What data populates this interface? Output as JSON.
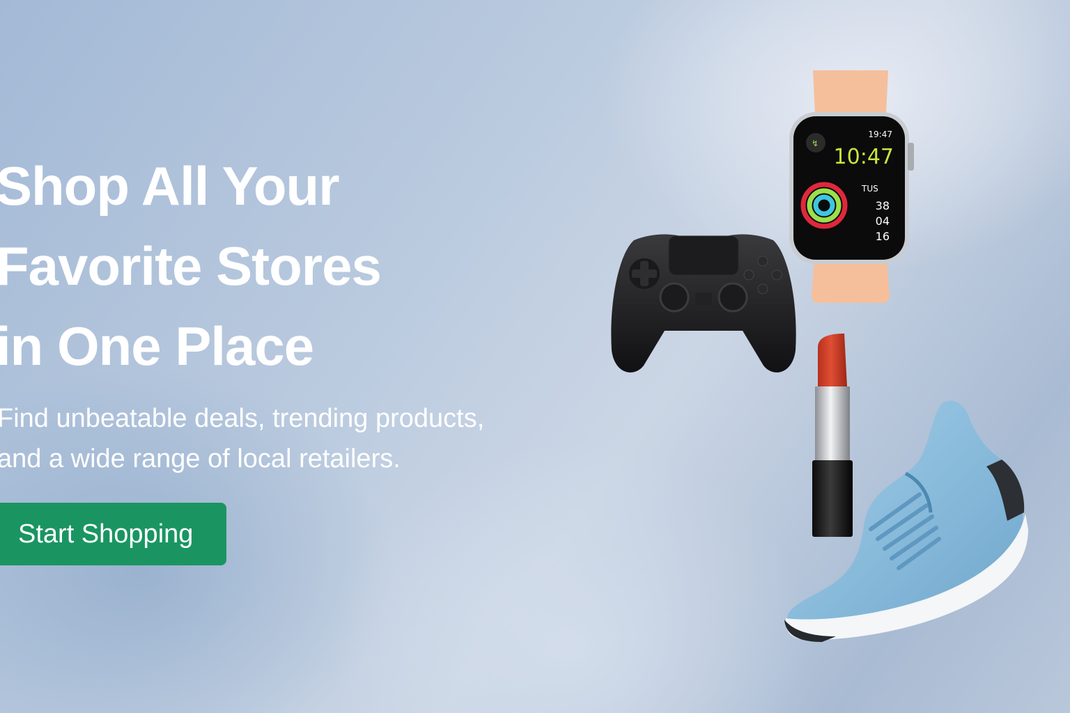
{
  "hero": {
    "headline_lines": [
      "Shop All Your",
      "Favorite Stores",
      "in One Place"
    ],
    "subtitle_lines": [
      "Find unbeatable deals, trending products,",
      "and a wide range of local retailers."
    ],
    "cta_label": "Start Shopping"
  },
  "watch_face": {
    "top_time": "19:47",
    "main_time": "10:47",
    "day": "TUS",
    "stats": [
      "38",
      "04",
      "16"
    ]
  },
  "colors": {
    "cta_background": "#1a9561",
    "headline_text": "#ffffff",
    "watch_band": "#f5bf9c",
    "watch_time_accent": "#c8e63c",
    "lipstick": "#d1412a",
    "sneaker": "#8fc0e0"
  },
  "icons": [
    "game-controller-icon",
    "smartwatch-icon",
    "lipstick-icon",
    "sneaker-icon",
    "activity-icon"
  ]
}
